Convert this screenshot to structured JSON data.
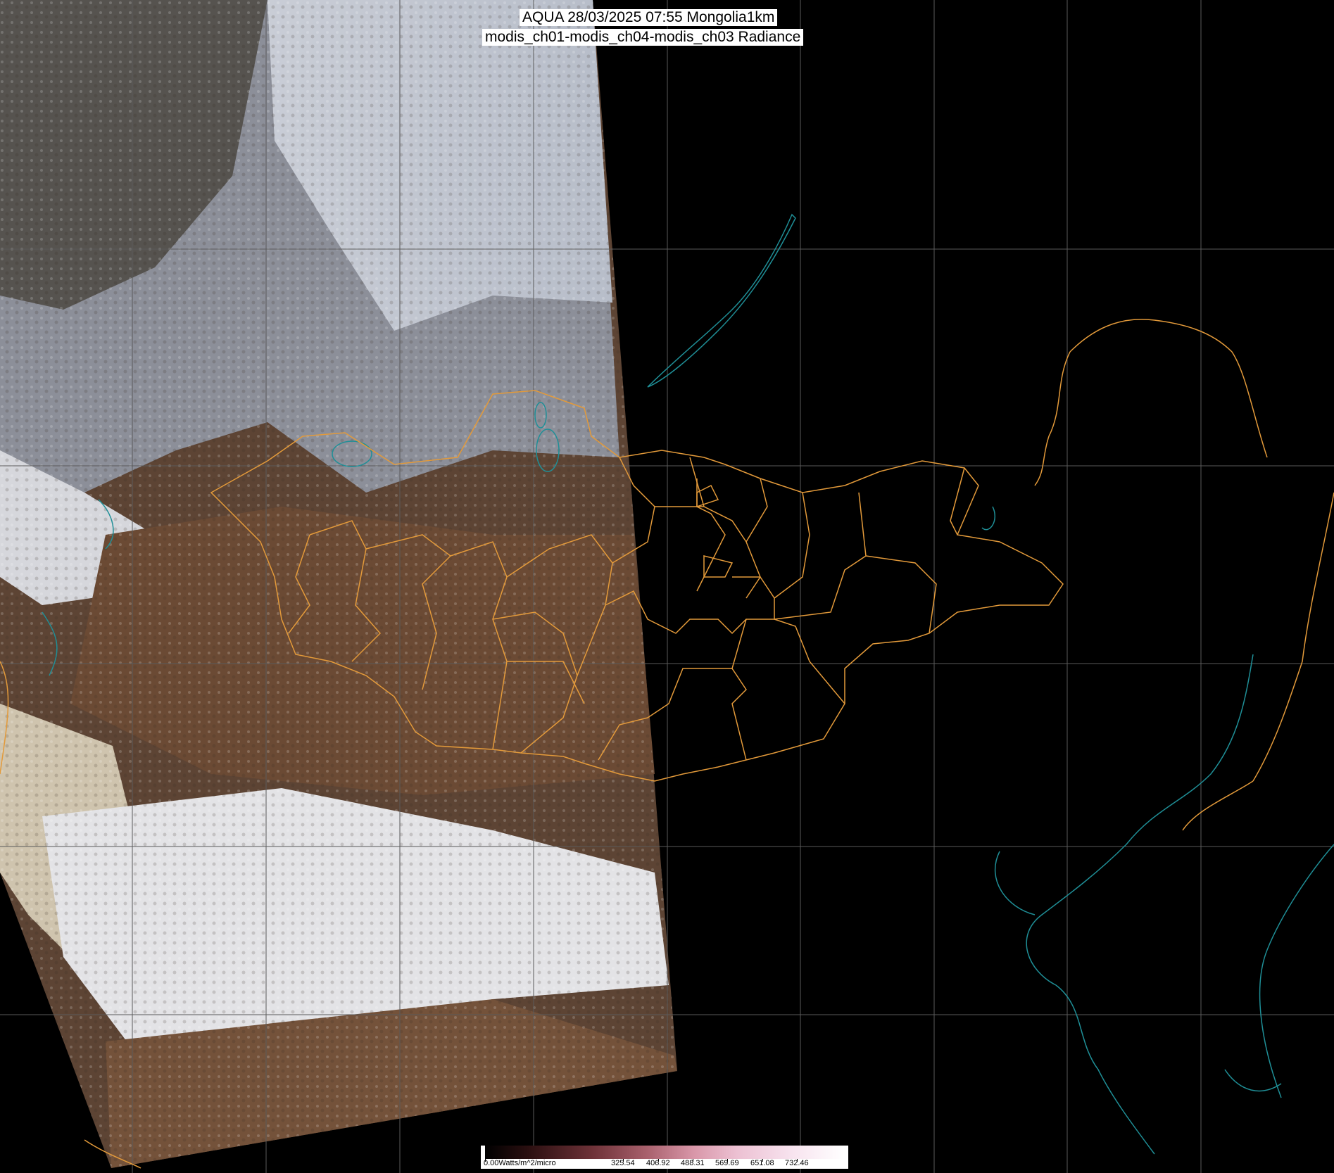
{
  "title": {
    "line1": "AQUA 28/03/2025 07:55 Mongolia1km",
    "line2": "modis_ch01-modis_ch04-modis_ch03 Radiance"
  },
  "legend": {
    "unit_label": "0.00Watts/m^2/micro",
    "ticks": [
      "325.54",
      "406.92",
      "488.31",
      "569.69",
      "651.08",
      "732.46"
    ],
    "colors": [
      "#000000",
      "#6e3238",
      "#d896a8",
      "#ffffff"
    ]
  },
  "colors": {
    "admin_boundaries": "#e39a3a",
    "coastlines_lakes": "#1f8f97",
    "graticule": "#5a5a5a",
    "background": "#000000"
  }
}
